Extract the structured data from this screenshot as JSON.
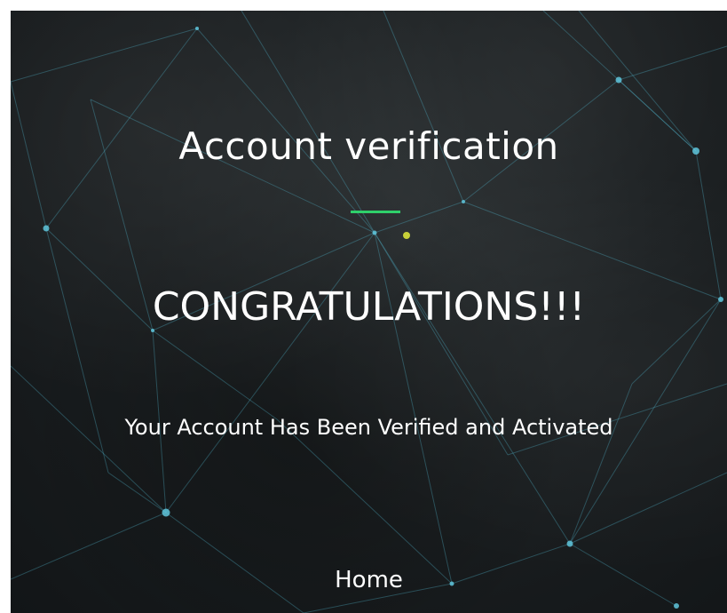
{
  "page": {
    "title": "Account verification",
    "headline": "CONGRATULATIONS!!!",
    "message": "Your Account Has Been Verified and Activated",
    "home_link": "Home"
  },
  "colors": {
    "accent": "#2fd06a",
    "network_line": "#4fb3c8",
    "text": "#ffffff"
  }
}
